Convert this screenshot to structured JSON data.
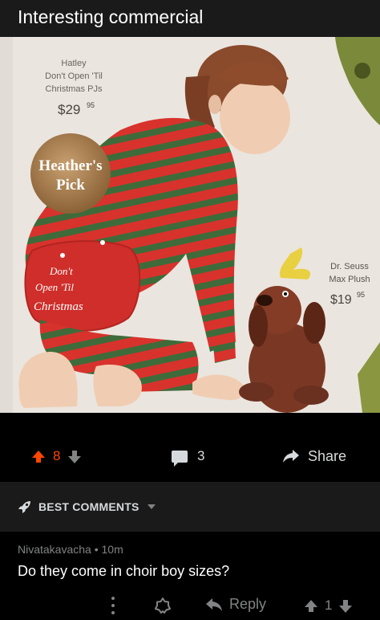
{
  "post": {
    "title": "Interesting commercial"
  },
  "image": {
    "left_caption": [
      "Hatley",
      "Don't Open 'Til",
      "Christmas PJs"
    ],
    "left_price": "$29",
    "left_price_cents": "95",
    "badge_line1": "Heather's",
    "badge_line2": "Pick",
    "flap_line1": "Don't",
    "flap_line2": "Open 'Til",
    "flap_line3": "Christmas",
    "right_caption": [
      "Dr. Seuss",
      "Max Plush"
    ],
    "right_price": "$19",
    "right_price_cents": "95"
  },
  "actions": {
    "vote_count": "8",
    "comment_count": "3",
    "share_label": "Share"
  },
  "comments_header": {
    "label": "BEST COMMENTS"
  },
  "comment": {
    "meta": "Nivatakavacha • 10m",
    "body": "Do they come in choir boy sizes?",
    "reply_label": "Reply",
    "vote_count": "1"
  },
  "colors": {
    "upvote": "#ff4500",
    "muted": "#818384",
    "panel": "#1a1a1b"
  }
}
